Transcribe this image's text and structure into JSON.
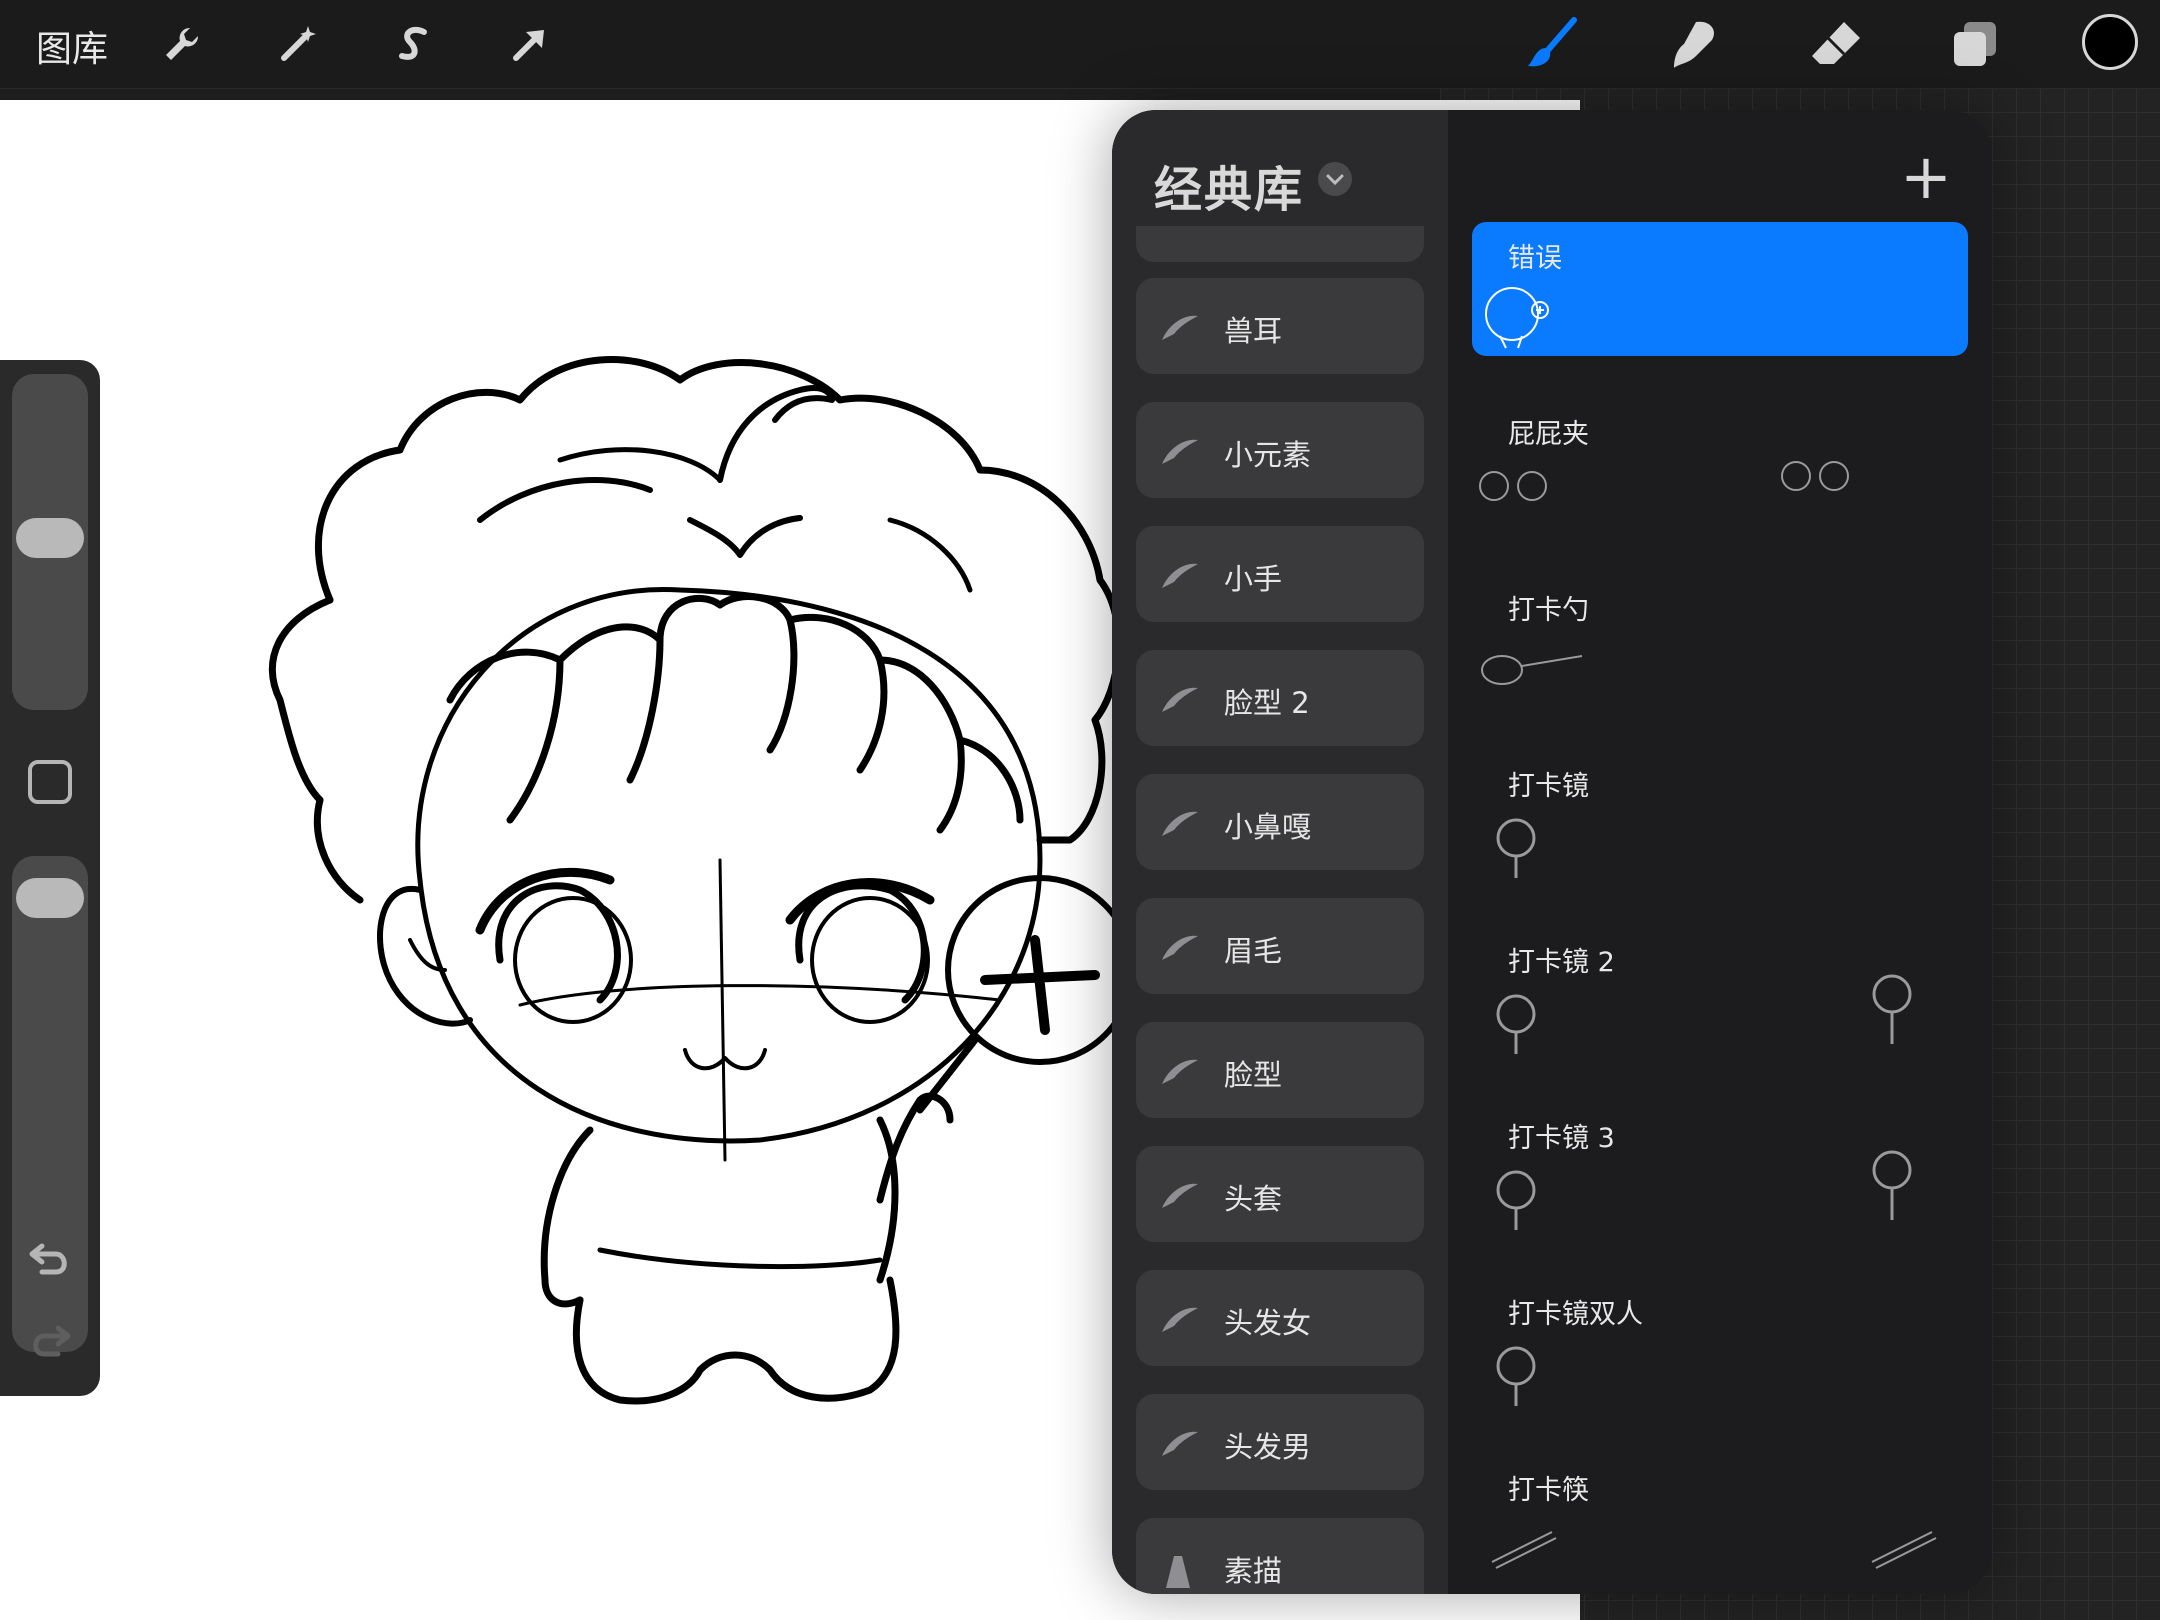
{
  "topbar": {
    "gallery_label": "图库",
    "tools": [
      {
        "name": "actions",
        "icon": "wrench-icon"
      },
      {
        "name": "adjustments",
        "icon": "magic-wand-icon"
      },
      {
        "name": "selection",
        "icon": "selection-s-icon"
      },
      {
        "name": "transform",
        "icon": "arrow-cursor-icon"
      }
    ],
    "right_tools": [
      {
        "name": "brush",
        "icon": "brush-icon",
        "active": true
      },
      {
        "name": "smudge",
        "icon": "smudge-icon"
      },
      {
        "name": "eraser",
        "icon": "eraser-icon"
      },
      {
        "name": "layers",
        "icon": "layers-icon"
      }
    ],
    "current_color": "#000000",
    "accent": "#0a7aff"
  },
  "panel": {
    "title": "经典库",
    "add_label": "+",
    "brush_sets": [
      {
        "label": "兽耳",
        "icon": "feather-icon"
      },
      {
        "label": "小元素",
        "icon": "feather-icon"
      },
      {
        "label": "小手",
        "icon": "feather-icon"
      },
      {
        "label": "脸型 2",
        "icon": "feather-icon"
      },
      {
        "label": "小鼻嘎",
        "icon": "feather-icon"
      },
      {
        "label": "眉毛",
        "icon": "feather-icon"
      },
      {
        "label": "脸型",
        "icon": "feather-icon"
      },
      {
        "label": "头套",
        "icon": "feather-icon"
      },
      {
        "label": "头发女",
        "icon": "feather-icon"
      },
      {
        "label": "头发男",
        "icon": "feather-icon"
      },
      {
        "label": "素描",
        "icon": "pencil-icon"
      }
    ],
    "brushes": [
      {
        "label": "错误",
        "selected": true
      },
      {
        "label": "屁屁夹",
        "selected": false
      },
      {
        "label": "打卡勺",
        "selected": false
      },
      {
        "label": "打卡镜",
        "selected": false
      },
      {
        "label": "打卡镜 2",
        "selected": false
      },
      {
        "label": "打卡镜 3",
        "selected": false
      },
      {
        "label": "打卡镜双人",
        "selected": false
      },
      {
        "label": "打卡筷",
        "selected": false
      }
    ]
  }
}
